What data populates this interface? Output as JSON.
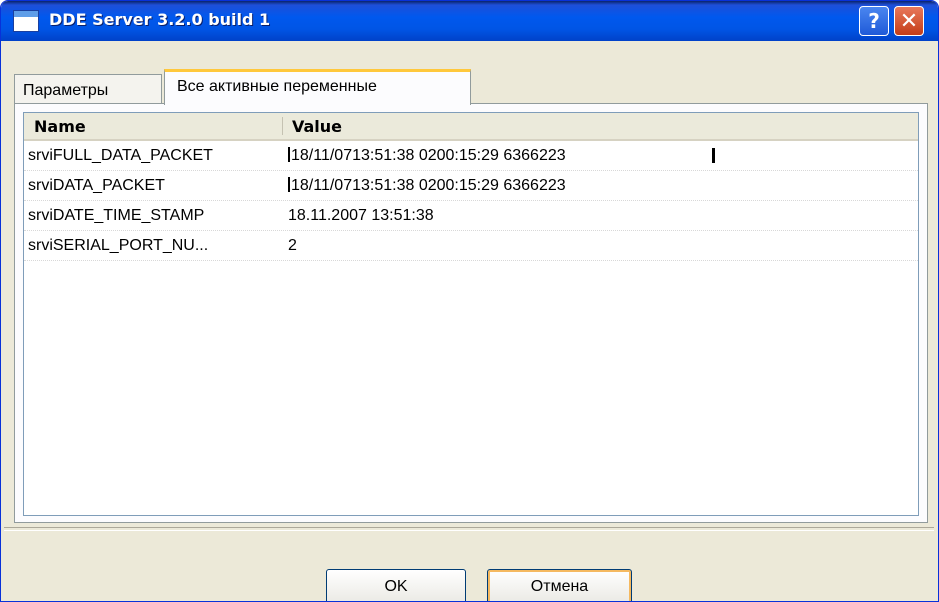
{
  "window": {
    "title": "DDE Server 3.2.0 build 1",
    "help_label": "?",
    "close_label": "✕"
  },
  "tabs": [
    {
      "label": "Параметры",
      "active": false
    },
    {
      "label": "Все активные переменные",
      "active": true
    }
  ],
  "table": {
    "columns": [
      "Name",
      "Value"
    ],
    "rows": [
      {
        "name": "srviFULL_DATA_PACKET",
        "value": "18/11/0713:51:38  0200:15:29 6366223"
      },
      {
        "name": "srviDATA_PACKET",
        "value": "18/11/0713:51:38  0200:15:29 6366223"
      },
      {
        "name": "srviDATE_TIME_STAMP",
        "value": "18.11.2007 13:51:38"
      },
      {
        "name": "srviSERIAL_PORT_NU...",
        "value": "2"
      }
    ]
  },
  "buttons": {
    "ok": "OK",
    "cancel": "Отмена"
  },
  "colors": {
    "titlebar": "#0055e5",
    "face": "#ece9d8",
    "tab_highlight": "#ffc83c",
    "close": "#c43d18"
  }
}
